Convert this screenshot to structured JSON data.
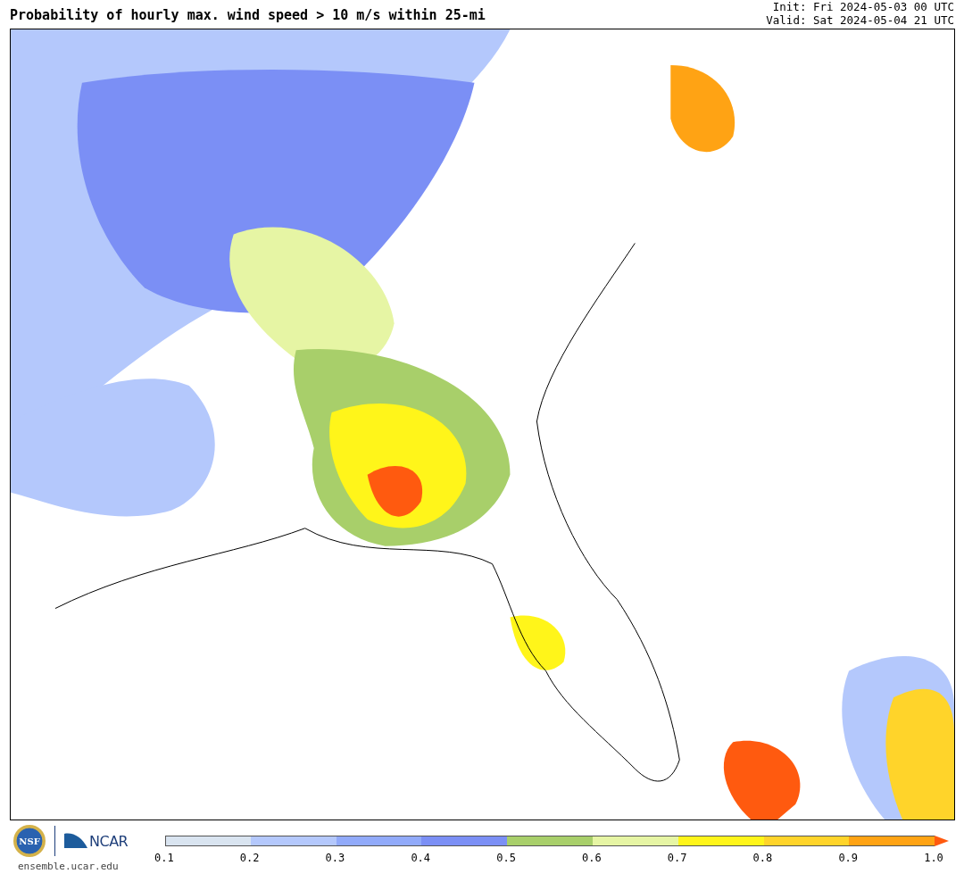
{
  "header": {
    "title": "Probability of hourly max. wind speed > 10 m/s within 25-mi",
    "init": "Init: Fri 2024-05-03 00 UTC",
    "valid": "Valid: Sat 2024-05-04 21 UTC"
  },
  "footer": {
    "nsf_logo": "NSF",
    "ncar_logo": "NCAR",
    "url": "ensemble.ucar.edu"
  },
  "colorbar": {
    "bins": [
      {
        "color": "#d9e4f0"
      },
      {
        "color": "#b4c8fc"
      },
      {
        "color": "#91aafa"
      },
      {
        "color": "#7b8ff5"
      },
      {
        "color": "#a8cf6a"
      },
      {
        "color": "#e6f5a4"
      },
      {
        "color": "#fff51a"
      },
      {
        "color": "#ffd42a"
      },
      {
        "color": "#ffa314"
      },
      {
        "color": "#ff5a0f",
        "kind": "arrow"
      }
    ],
    "ticks": [
      "0.1",
      "0.2",
      "0.3",
      "0.4",
      "0.5",
      "0.6",
      "0.7",
      "0.8",
      "0.9",
      "1.0"
    ]
  }
}
